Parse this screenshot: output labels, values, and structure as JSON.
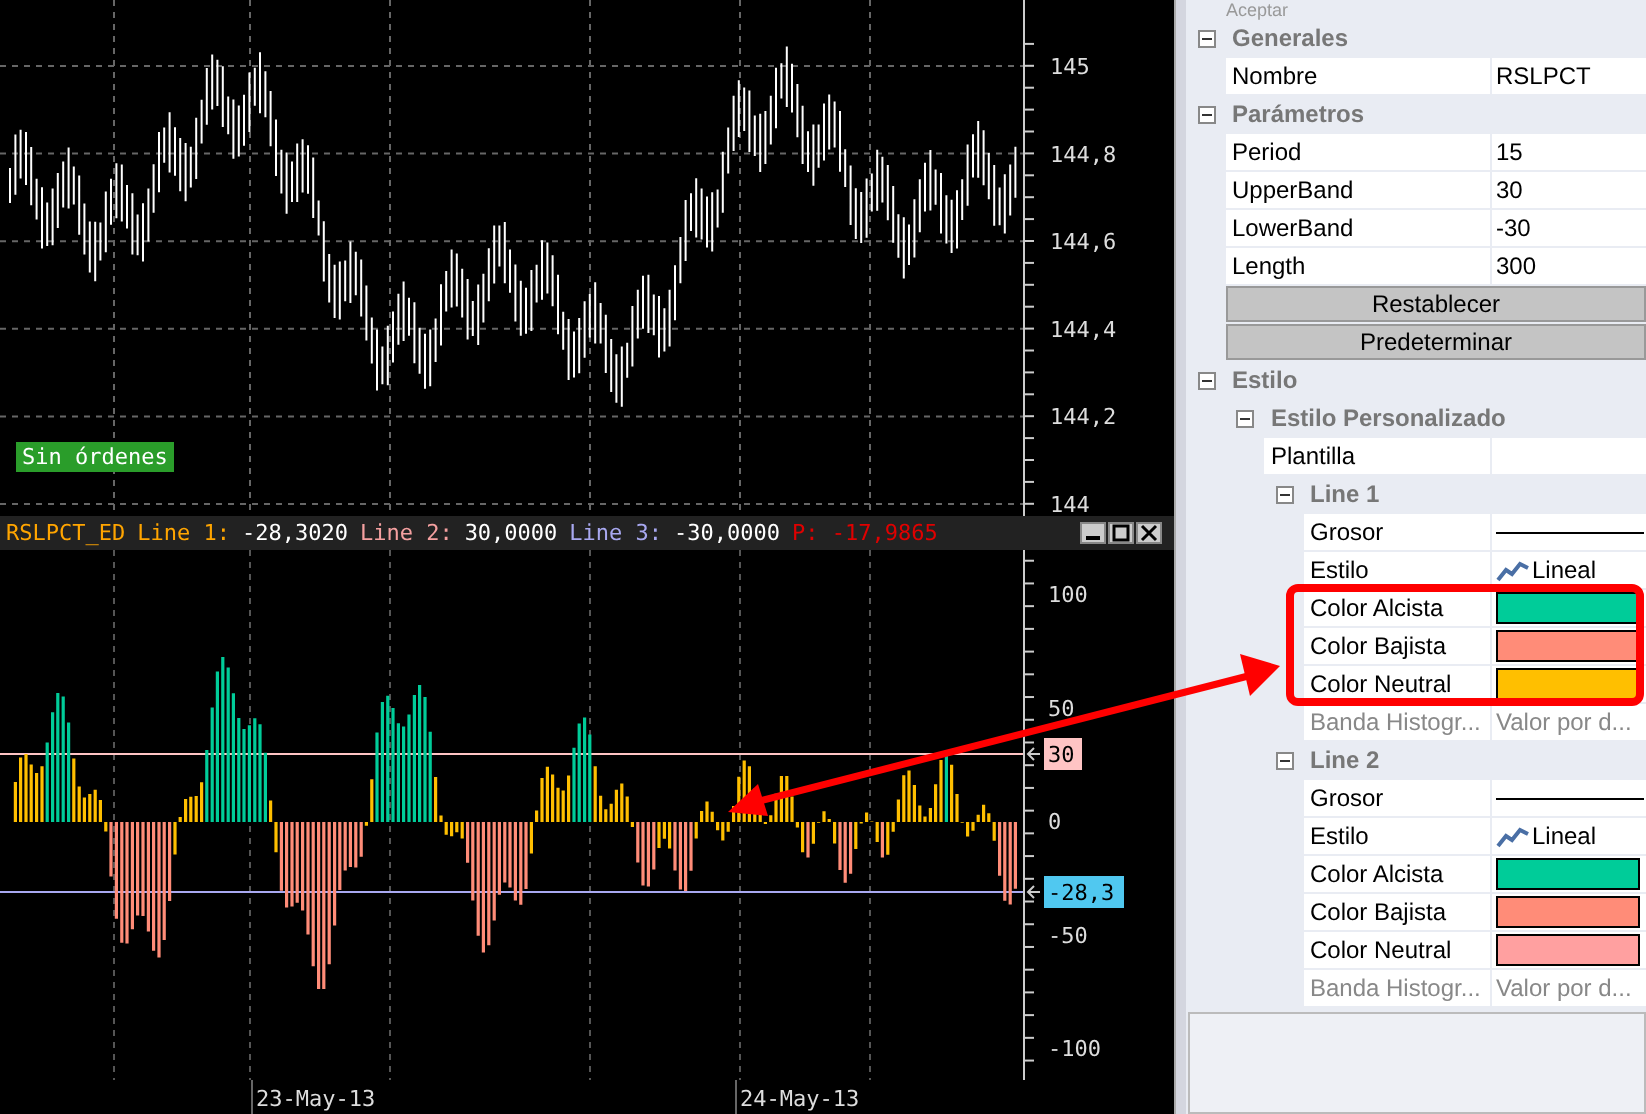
{
  "price_chart": {
    "y_labels": [
      "145",
      "144,8",
      "144,6",
      "144,4",
      "144,2",
      "144"
    ],
    "order_badge": "Sin órdenes"
  },
  "indicator_header": {
    "items": [
      {
        "text": "RSLPCT_ED",
        "color": "#ffa500"
      },
      {
        "text": "Line 1:",
        "color": "#ffa500"
      },
      {
        "text": "-28,3020",
        "color": "#ffffff"
      },
      {
        "text": "Line 2:",
        "color": "#f4a0a0"
      },
      {
        "text": "30,0000",
        "color": "#ffffff"
      },
      {
        "text": "Line 3:",
        "color": "#a8a8f0"
      },
      {
        "text": "-30,0000",
        "color": "#ffffff"
      },
      {
        "text": "P: -17,9865",
        "color": "#e00000"
      }
    ]
  },
  "indicator_chart": {
    "y_labels": [
      "100",
      "50",
      "0",
      "-50",
      "-100"
    ],
    "markers": [
      {
        "text": "30",
        "color": "#ffc4c4"
      },
      {
        "text": "-28,3",
        "color": "#50c8f0"
      }
    ]
  },
  "date_axis": [
    "23-May-13",
    "24-May-13"
  ],
  "toolbar": {
    "button": "Aceptar"
  },
  "properties": [
    {
      "label": "Generales",
      "expanded": true,
      "children": [
        {
          "kind": "text",
          "name": "Nombre",
          "value": "RSLPCT",
          "disabled": false
        }
      ]
    },
    {
      "label": "Parámetros",
      "expanded": true,
      "children": [
        {
          "kind": "text",
          "name": "Period",
          "value": "15",
          "disabled": false
        },
        {
          "kind": "text",
          "name": "UpperBand",
          "value": "30",
          "disabled": false
        },
        {
          "kind": "text",
          "name": "LowerBand",
          "value": "-30",
          "disabled": false
        },
        {
          "kind": "text",
          "name": "Length",
          "value": "300",
          "disabled": false
        },
        {
          "kind": "button",
          "label": "Restablecer"
        },
        {
          "kind": "button",
          "label": "Predeterminar"
        }
      ]
    },
    {
      "label": "Estilo",
      "expanded": true,
      "children": [
        {
          "kind": "group",
          "label": "Estilo Personalizado",
          "expanded": true,
          "children": [
            {
              "kind": "text",
              "name": "Plantilla",
              "disabled": false
            },
            {
              "kind": "group",
              "label": "Line 1",
              "expanded": true,
              "children": [
                {
                  "kind": "thickness",
                  "name": "Grosor"
                },
                {
                  "kind": "style",
                  "name": "Estilo",
                  "value": "Lineal"
                },
                {
                  "kind": "color",
                  "name": "Color Alcista",
                  "color": "#00cc99"
                },
                {
                  "kind": "color",
                  "name": "Color Bajista",
                  "color": "#ff8c78"
                },
                {
                  "kind": "color",
                  "name": "Color Neutral",
                  "color": "#ffbf00"
                },
                {
                  "kind": "text",
                  "name": "Banda Histogr...",
                  "value": "Valor por d...",
                  "disabled": true
                }
              ]
            },
            {
              "kind": "group",
              "label": "Line 2",
              "expanded": true,
              "children": [
                {
                  "kind": "thickness",
                  "name": "Grosor"
                },
                {
                  "kind": "style",
                  "name": "Estilo",
                  "value": "Lineal"
                },
                {
                  "kind": "color",
                  "name": "Color Alcista",
                  "color": "#00cc99"
                },
                {
                  "kind": "color",
                  "name": "Color Bajista",
                  "color": "#ff8c78"
                },
                {
                  "kind": "color",
                  "name": "Color Neutral",
                  "color": "#ffa0a0"
                },
                {
                  "kind": "text",
                  "name": "Banda Histogr...",
                  "value": "Valor por d...",
                  "disabled": true
                }
              ]
            }
          ]
        }
      ]
    }
  ]
}
